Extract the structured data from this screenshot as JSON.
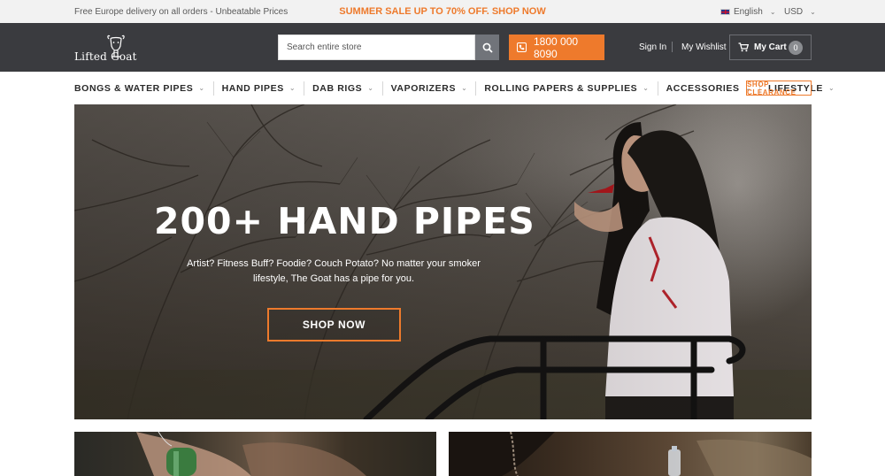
{
  "topbar": {
    "delivery_text": "Free Europe delivery on all orders - Unbeatable Prices",
    "promo_text": "SUMMER SALE UP TO 70% OFF. SHOP NOW",
    "language": "English",
    "currency": "USD"
  },
  "header": {
    "logo_text": "Lifted Goat",
    "search_placeholder": "Search entire store",
    "phone": "1800 000 8090",
    "sign_in": "Sign In",
    "wishlist": "My Wishlist",
    "cart_label": "My Cart",
    "cart_count": "0"
  },
  "nav": {
    "items": [
      {
        "label": "BONGS & WATER PIPES"
      },
      {
        "label": "HAND PIPES"
      },
      {
        "label": "DAB RIGS"
      },
      {
        "label": "VAPORIZERS"
      },
      {
        "label": "ROLLING PAPERS & SUPPLIES"
      },
      {
        "label": "ACCESSORIES"
      },
      {
        "label": "LIFESTYLE"
      }
    ],
    "clearance": "SHOP CLEARANCE"
  },
  "hero": {
    "title": "200+ HAND PIPES",
    "subtitle": "Artist? Fitness Buff? Foodie? Couch Potato? No matter your smoker lifestyle, The Goat has a pipe for you.",
    "cta": "SHOP NOW"
  },
  "colors": {
    "accent": "#ee7a2c",
    "header_bg": "#3a3b3f",
    "topbar_bg": "#f2f2f2"
  },
  "icons": [
    "goat-logo-icon",
    "search-icon",
    "phone-icon",
    "cart-icon",
    "chevron-down-icon",
    "flag-uk-icon"
  ]
}
